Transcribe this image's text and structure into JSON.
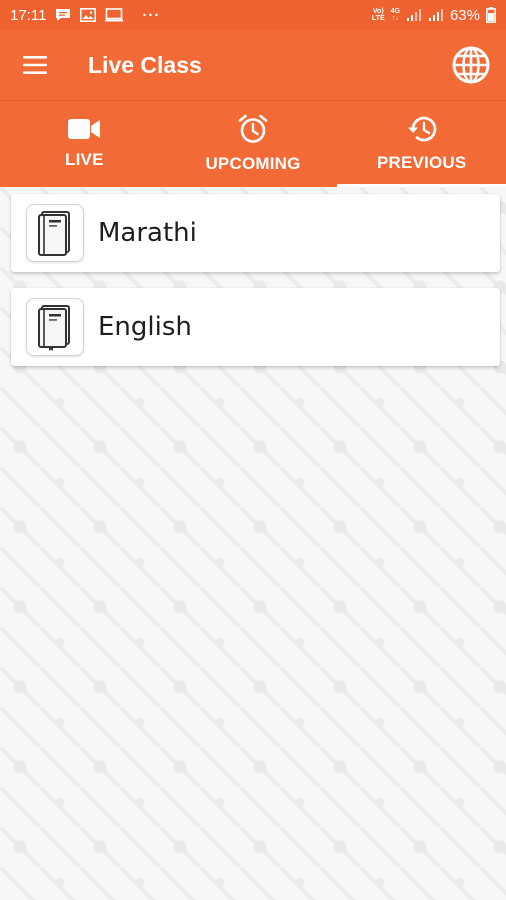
{
  "status_bar": {
    "time": "17:11",
    "left_icons": [
      "chat-icon",
      "image-icon",
      "screen-icon"
    ],
    "more": "···",
    "network": [
      "Vo)",
      "LTE"
    ],
    "network2": [
      "4G",
      "↑↓"
    ],
    "battery": "63%"
  },
  "app_bar": {
    "title": "Live Class",
    "menu_icon": "hamburger-menu-icon",
    "action_icon": "globe-icon"
  },
  "tabs": [
    {
      "label": "LIVE",
      "icon": "video-camera-icon",
      "active": false
    },
    {
      "label": "UPCOMING",
      "icon": "alarm-clock-icon",
      "active": false
    },
    {
      "label": "PREVIOUS",
      "icon": "history-icon",
      "active": true
    }
  ],
  "courses": [
    {
      "name": "Marathi",
      "icon": "book-icon"
    },
    {
      "name": "English",
      "icon": "book-icon"
    }
  ],
  "colors": {
    "primary": "#f26a35",
    "status_bar": "#f0622f",
    "background": "#f7f7f7",
    "card": "#ffffff",
    "text": "#1e1e1e"
  }
}
